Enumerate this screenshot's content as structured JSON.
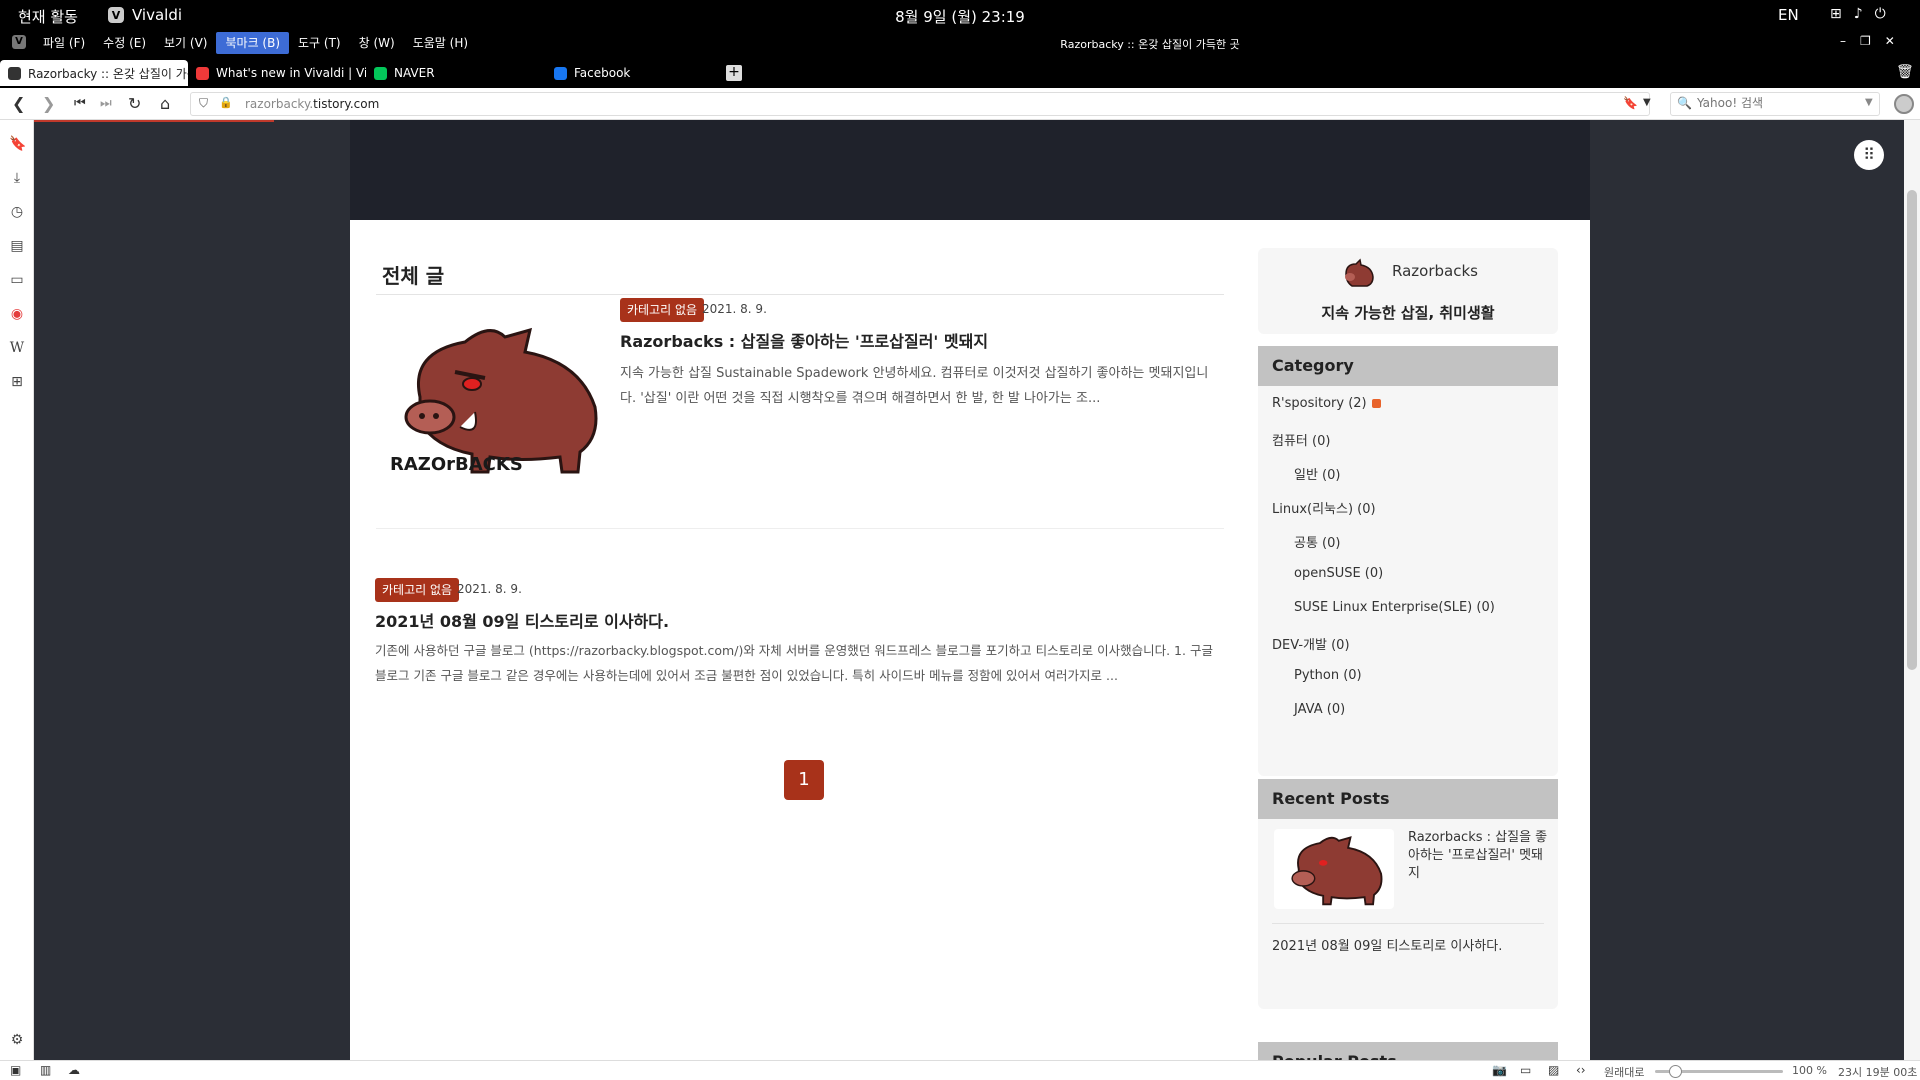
{
  "system_bar": {
    "activities": "현재 활동",
    "app_name": "Vivaldi",
    "clock": "8월 9일 (월) 23:19",
    "lang": "EN"
  },
  "menubar": {
    "items": [
      "파일 (F)",
      "수정 (E)",
      "보기 (V)",
      "북마크 (B)",
      "도구 (T)",
      "창 (W)",
      "도움말 (H)"
    ],
    "active_index": 3,
    "window_title": "Razorbacky :: 온갖 삽질이 가득한 곳"
  },
  "tabs": [
    {
      "label": "Razorbacky :: 온갖 삽질이 가득",
      "active": true,
      "icon": "page-icon",
      "color": "#333333"
    },
    {
      "label": "What's new in Vivaldi | Viva",
      "active": false,
      "icon": "vivaldi-icon",
      "color": "#ef3939"
    },
    {
      "label": "NAVER",
      "active": false,
      "icon": "naver-icon",
      "color": "#03c75a"
    },
    {
      "label": "Facebook",
      "active": false,
      "icon": "facebook-icon",
      "color": "#1877f2"
    }
  ],
  "address": {
    "url_prefix": "razorbacky.",
    "url_domain": "tistory.com",
    "search_placeholder": "Yahoo! 검색"
  },
  "blog": {
    "section_title": "전체 글",
    "posts": [
      {
        "category": "카테고리 없음",
        "date": "2021. 8. 9.",
        "title": "Razorbacks : 삽질을 좋아하는 '프로삽질러' 멧돼지",
        "excerpt": "지속 가능한 삽질 Sustainable Spadework 안녕하세요. 컴퓨터로 이것저것 삽질하기 좋아하는 멧돼지입니다. '삽질' 이란 어떤 것을 직접 시행착오를 겪으며 해결하면서 한 발, 한 발 나아가는 조..."
      },
      {
        "category": "카테고리 없음",
        "date": "2021. 8. 9.",
        "title": "2021년 08월 09일 티스토리로 이사하다.",
        "excerpt": "기존에 사용하던 구글 블로그 (https://razorbacky.blogspot.com/)와 자체 서버를 운영했던 워드프레스 블로그를 포기하고 티스토리로 이사했습니다. 1. 구글 블로그 기존 구글 블로그 같은 경우에는 사용하는데에 있어서 조금 불편한 점이 있었습니다. 특히 사이드바 메뉴를 정함에 있어서 여러가지로 ..."
      }
    ],
    "page_number": "1"
  },
  "sidebar": {
    "profile_name": "Razorbacks",
    "profile_desc": "지속 가능한 삽질, 취미생활",
    "category_title": "Category",
    "categories": [
      {
        "label": "R'spository (2)",
        "indent": false,
        "rss": true
      },
      {
        "label": "컴퓨터 (0)",
        "indent": false,
        "rss": false
      },
      {
        "label": "일반 (0)",
        "indent": true,
        "rss": false
      },
      {
        "label": "Linux(리눅스) (0)",
        "indent": false,
        "rss": false
      },
      {
        "label": "공통 (0)",
        "indent": true,
        "rss": false
      },
      {
        "label": "openSUSE (0)",
        "indent": true,
        "rss": false
      },
      {
        "label": "SUSE Linux Enterprise(SLE) (0)",
        "indent": true,
        "rss": false
      },
      {
        "label": "DEV-개발 (0)",
        "indent": false,
        "rss": false
      },
      {
        "label": "Python (0)",
        "indent": true,
        "rss": false
      },
      {
        "label": "JAVA (0)",
        "indent": true,
        "rss": false
      }
    ],
    "recent_title": "Recent Posts",
    "recent": [
      "Razorbacks : 삽질을 좋아하는 '프로삽질러' 멧돼지",
      "2021년 08월 09일 티스토리로 이사하다."
    ],
    "popular_title": "Popular Posts"
  },
  "statusbar": {
    "reset_label": "원래대로",
    "zoom": "100 %",
    "time": "23시 19분 00초"
  },
  "colors": {
    "accent": "#a8321a",
    "menu_active": "#3d6cd6",
    "page_bg": "#2b2e36"
  }
}
